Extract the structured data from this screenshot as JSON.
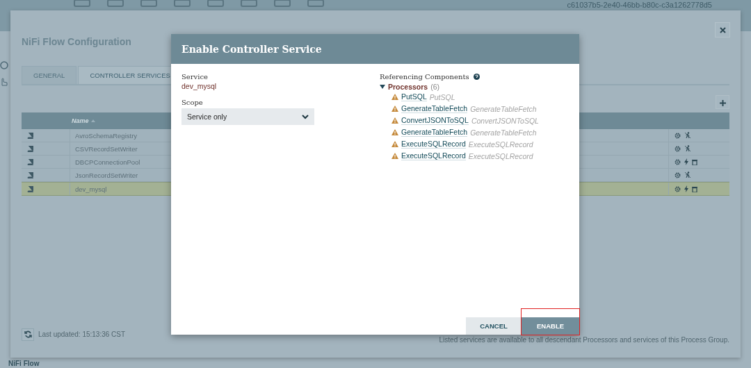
{
  "toolbar": {
    "flow_id": "c61037b5-2e40-46bb-b80c-c3a1262778d5"
  },
  "config": {
    "title": "NiFi Flow Configuration",
    "tabs": [
      {
        "label": "GENERAL",
        "selected": false
      },
      {
        "label": "CONTROLLER SERVICES",
        "selected": true
      }
    ],
    "table": {
      "columns": [
        "Name"
      ],
      "rows": [
        {
          "name": "AvroSchemaRegistry",
          "enabled": true,
          "selected": false
        },
        {
          "name": "CSVRecordSetWriter",
          "enabled": true,
          "selected": false
        },
        {
          "name": "DBCPConnectionPool",
          "enabled": false,
          "selected": false
        },
        {
          "name": "JsonRecordSetWriter",
          "enabled": true,
          "selected": false
        },
        {
          "name": "dev_mysql",
          "enabled": false,
          "selected": true
        }
      ]
    },
    "last_updated": "Last updated: 15:13:36 CST",
    "note": "Listed services are available to all descendant Processors and services of this Process Group."
  },
  "breadcrumb": "NiFi Flow",
  "dialog": {
    "title": "Enable Controller Service",
    "service_label": "Service",
    "service": "dev_mysql",
    "scope_label": "Scope",
    "scope": "Service only",
    "referencing_label": "Referencing Components",
    "groups": [
      {
        "name": "Processors",
        "count": "(6)",
        "expanded": true,
        "items": [
          {
            "name": "PutSQL",
            "type": "PutSQL"
          },
          {
            "name": "GenerateTableFetch",
            "type": "GenerateTableFetch"
          },
          {
            "name": "ConvertJSONToSQL",
            "type": "ConvertJSONToSQL"
          },
          {
            "name": "GenerateTableFetch",
            "type": "GenerateTableFetch"
          },
          {
            "name": "ExecuteSQLRecord",
            "type": "ExecuteSQLRecord"
          },
          {
            "name": "ExecuteSQLRecord",
            "type": "ExecuteSQLRecord"
          }
        ]
      }
    ],
    "buttons": [
      {
        "label": "CANCEL",
        "kind": "secondary",
        "highlighted": false
      },
      {
        "label": "ENABLE",
        "kind": "primary",
        "highlighted": true
      }
    ]
  }
}
